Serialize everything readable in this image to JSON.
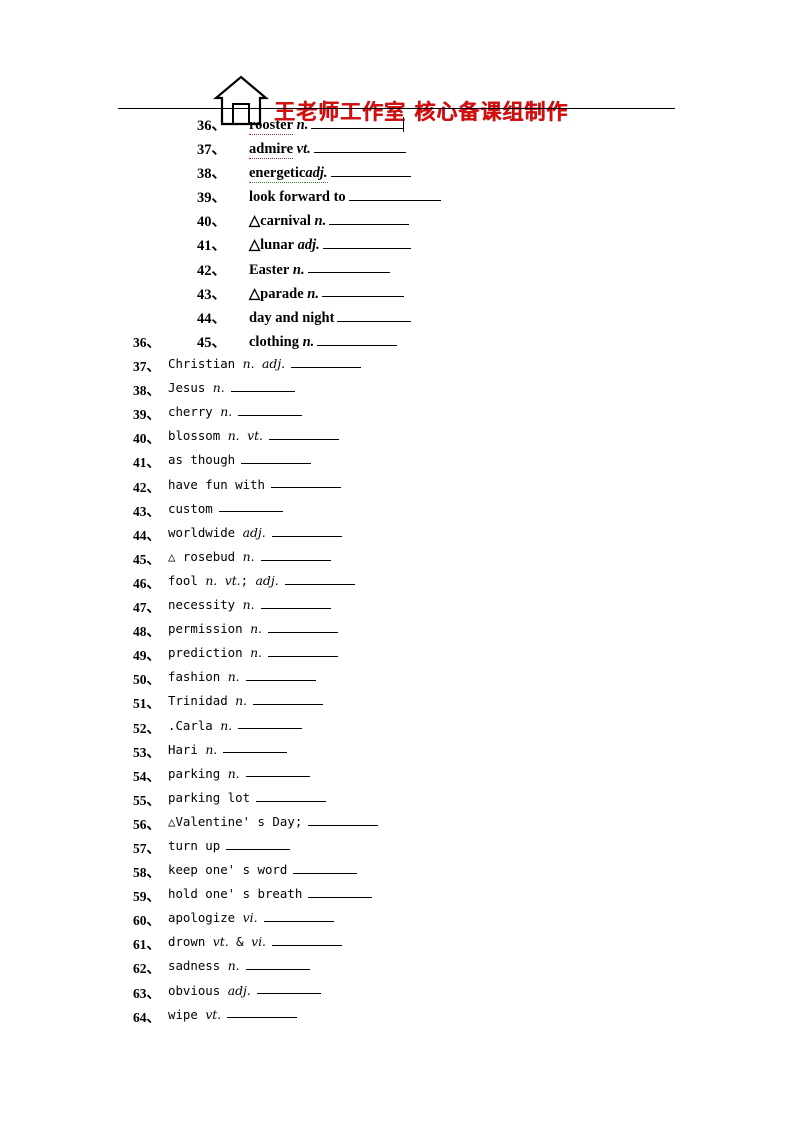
{
  "header": {
    "brand_text": "王老师工作室  核心备课组制作",
    "brand_color": "#d01010",
    "logo_icon": "house-icon"
  },
  "top_list": [
    {
      "num": "36、",
      "text": "rooster",
      "pos": "n.",
      "blank_width": 92,
      "mark": "",
      "underline": "red",
      "cursor": true
    },
    {
      "num": "37、",
      "text": "admire",
      "pos": "vt.",
      "blank_width": 92,
      "mark": "",
      "underline": "red",
      "cursor": false
    },
    {
      "num": "38、",
      "text": "energetic",
      "pos": "adj.",
      "blank_width": 80,
      "mark": "",
      "underline": "green",
      "cursor": false
    },
    {
      "num": "39、",
      "text": "look forward to",
      "pos": "",
      "blank_width": 92,
      "mark": "",
      "underline": "",
      "cursor": false
    },
    {
      "num": "40、",
      "text": "carnival",
      "pos": "n.",
      "blank_width": 80,
      "mark": "△",
      "underline": "",
      "cursor": false
    },
    {
      "num": "41、",
      "text": "lunar",
      "pos": "adj.",
      "blank_width": 88,
      "mark": "△",
      "underline": "",
      "cursor": false
    },
    {
      "num": "42、",
      "text": "Easter",
      "pos": "n.",
      "blank_width": 82,
      "mark": "",
      "underline": "",
      "cursor": false
    },
    {
      "num": "43、",
      "text": "parade",
      "pos": "n.",
      "blank_width": 82,
      "mark": "△",
      "underline": "",
      "cursor": false
    },
    {
      "num": "44、",
      "text": "day and night",
      "pos": "",
      "blank_width": 74,
      "mark": "",
      "underline": "",
      "cursor": false
    },
    {
      "num": "45、",
      "text": "clothing",
      "pos": "n.",
      "blank_width": 80,
      "mark": "",
      "underline": "",
      "cursor": false
    }
  ],
  "main_list": [
    {
      "num": "36、",
      "text": "",
      "blank_width": 0
    },
    {
      "num": "37、",
      "text": "Christian n.    adj.",
      "blank_width": 70
    },
    {
      "num": "38、",
      "text": "Jesus   n.",
      "blank_width": 64
    },
    {
      "num": "39、",
      "text": "cherry n.",
      "blank_width": 64
    },
    {
      "num": "40、",
      "text": "blossom n.   vt.",
      "blank_width": 70
    },
    {
      "num": "41、",
      "text": "as though",
      "blank_width": 70
    },
    {
      "num": "42、",
      "text": "have fun with",
      "blank_width": 70
    },
    {
      "num": "43、",
      "text": "custom",
      "blank_width": 64
    },
    {
      "num": "44、",
      "text": "worldwide adj.",
      "blank_width": 70
    },
    {
      "num": "45、",
      "text": "△ rosebud   n.",
      "blank_width": 70
    },
    {
      "num": "46、",
      "text": "fool n. vt.;  adj.",
      "blank_width": 70
    },
    {
      "num": "47、",
      "text": "necessity  n.",
      "blank_width": 70
    },
    {
      "num": "48、",
      "text": "permission n.",
      "blank_width": 70
    },
    {
      "num": "49、",
      "text": "prediction  n.",
      "blank_width": 70
    },
    {
      "num": "50、",
      "text": "fashion n.",
      "blank_width": 70
    },
    {
      "num": "51、",
      "text": "Trinidad n.",
      "blank_width": 70
    },
    {
      "num": "52、",
      "text": ".Carla n.",
      "blank_width": 64
    },
    {
      "num": "53、",
      "text": "Hari n.",
      "blank_width": 64
    },
    {
      "num": "54、",
      "text": "parking n.",
      "blank_width": 64
    },
    {
      "num": "55、",
      "text": "parking lot",
      "blank_width": 70
    },
    {
      "num": "56、",
      "text": "△Valentine' s Day;",
      "blank_width": 70
    },
    {
      "num": "57、",
      "text": "turn up",
      "blank_width": 64
    },
    {
      "num": "58、",
      "text": "keep one' s word",
      "blank_width": 64
    },
    {
      "num": "59、",
      "text": "hold one' s breath",
      "blank_width": 64
    },
    {
      "num": "60、",
      "text": "apologize vi.",
      "blank_width": 70
    },
    {
      "num": "61、",
      "text": "drown vt. & vi.",
      "blank_width": 70
    },
    {
      "num": "62、",
      "text": "sadness n.",
      "blank_width": 64
    },
    {
      "num": "63、",
      "text": "obvious adj.",
      "blank_width": 64
    },
    {
      "num": "64、",
      "text": "wipe vt.",
      "blank_width": 70
    }
  ]
}
